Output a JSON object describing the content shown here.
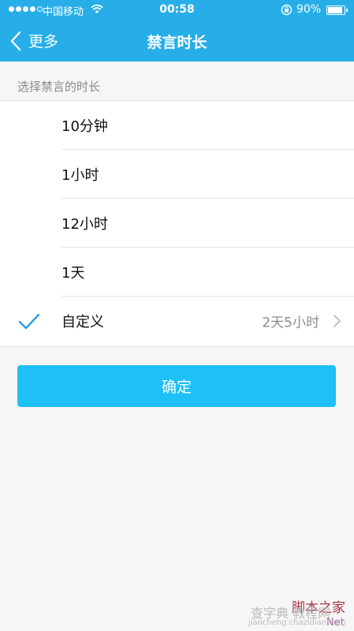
{
  "status_bar": {
    "carrier": "中国移动",
    "time": "00:58",
    "battery": "90%"
  },
  "nav": {
    "back_label": "更多",
    "title": "禁言时长"
  },
  "section_header": "选择禁言的时长",
  "options": [
    {
      "label": "10分钟",
      "selected": false
    },
    {
      "label": "1小时",
      "selected": false
    },
    {
      "label": "12小时",
      "selected": false
    },
    {
      "label": "1天",
      "selected": false
    },
    {
      "label": "自定义",
      "selected": true,
      "value": "2天5小时"
    }
  ],
  "confirm_label": "确定",
  "watermark": {
    "line1": "脚本之家",
    "line2": "查字典 教程网",
    "line3": "jiaocheng.chazidian.com",
    "line4": "Net"
  },
  "colors": {
    "accent": "#27aee8",
    "button": "#1ec0f5",
    "check": "#2a9ee8"
  }
}
